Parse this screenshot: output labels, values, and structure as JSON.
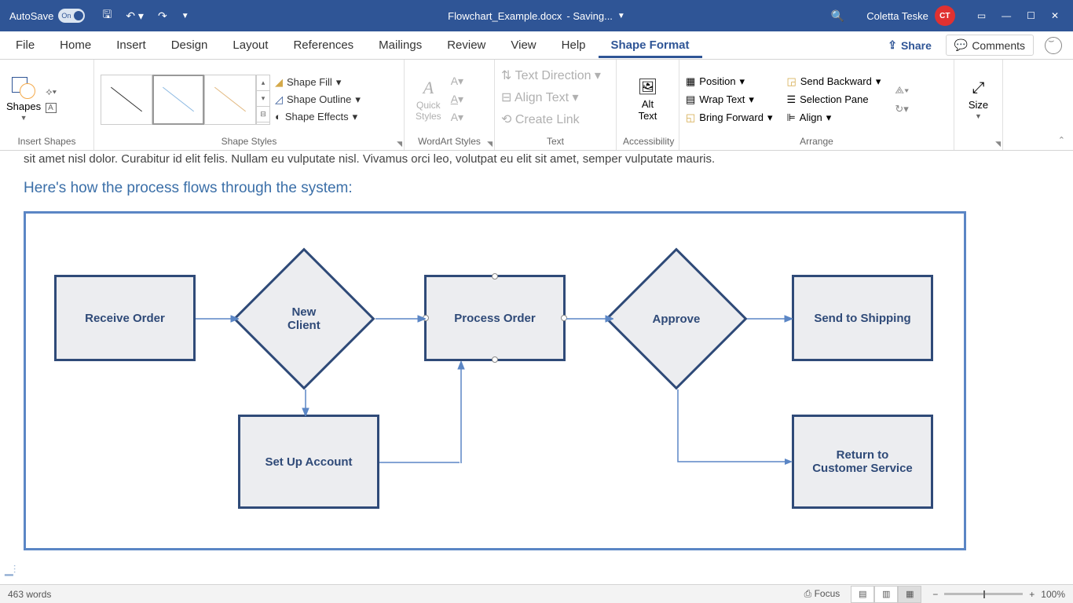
{
  "titlebar": {
    "autosave": "AutoSave",
    "doc_name": "Flowchart_Example.docx",
    "saving": "- Saving...",
    "user": "Coletta Teske",
    "initials": "CT"
  },
  "tabs": {
    "file": "File",
    "home": "Home",
    "insert": "Insert",
    "design": "Design",
    "layout": "Layout",
    "references": "References",
    "mailings": "Mailings",
    "review": "Review",
    "view": "View",
    "help": "Help",
    "shape_format": "Shape Format",
    "share": "Share",
    "comments": "Comments"
  },
  "ribbon": {
    "shapes": "Shapes",
    "insert_shapes": "Insert Shapes",
    "shape_styles": "Shape Styles",
    "shape_fill": "Shape Fill",
    "shape_outline": "Shape Outline",
    "shape_effects": "Shape Effects",
    "quick_styles": "Quick\nStyles",
    "wordart_styles": "WordArt Styles",
    "text_direction": "Text Direction",
    "align_text": "Align Text",
    "create_link": "Create Link",
    "text": "Text",
    "alt_text": "Alt\nText",
    "accessibility": "Accessibility",
    "position": "Position",
    "wrap_text": "Wrap Text",
    "bring_forward": "Bring Forward",
    "send_backward": "Send Backward",
    "selection_pane": "Selection Pane",
    "align": "Align",
    "arrange": "Arrange",
    "size": "Size"
  },
  "document": {
    "body_text_partial": "sit amet nisl dolor. Curabitur id elit felis. Nullam eu vulputate nisl. Vivamus orci leo, volutpat eu elit sit amet, semper vulputate mauris.",
    "heading": "Here's how the process flows through the system:",
    "shapes": {
      "receive_order": "Receive Order",
      "new_client": "New\nClient",
      "process_order": "Process Order",
      "approve": "Approve",
      "send_shipping": "Send to Shipping",
      "setup_account": "Set Up Account",
      "return_cs": "Return to\nCustomer Service"
    }
  },
  "status": {
    "words": "463 words",
    "focus": "Focus",
    "zoom": "100%"
  }
}
